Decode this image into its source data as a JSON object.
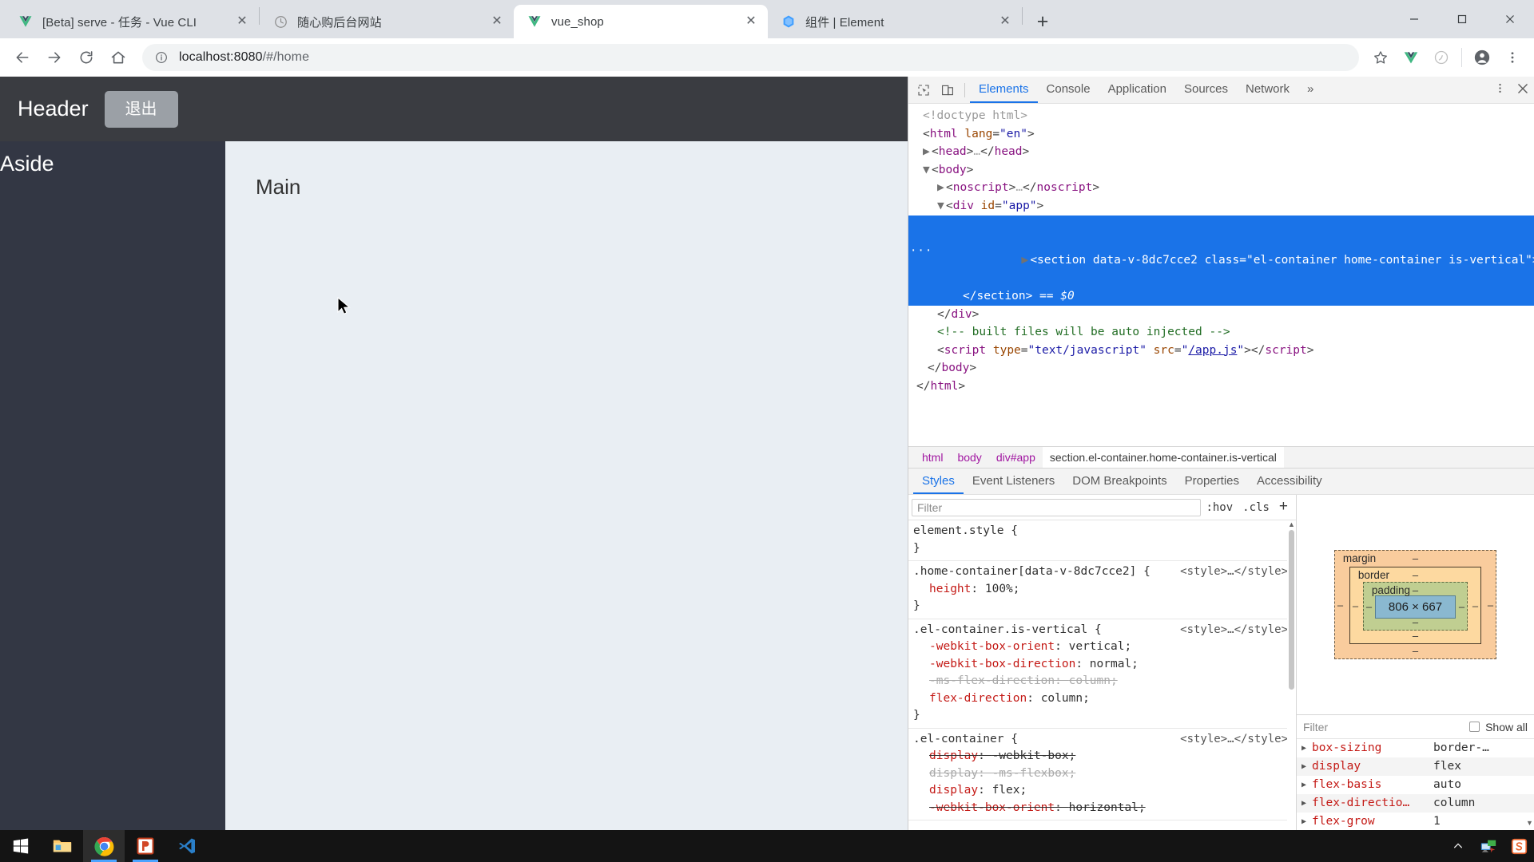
{
  "browser": {
    "tabs": [
      {
        "title": "[Beta] serve - 任务 - Vue CLI",
        "favicon": "vue-icon",
        "active": false,
        "close_label": "✕"
      },
      {
        "title": "随心购后台网站",
        "favicon": "clock-icon",
        "active": false,
        "close_label": "✕"
      },
      {
        "title": "vue_shop",
        "favicon": "vue-icon",
        "active": true,
        "close_label": "✕"
      },
      {
        "title": "组件 | Element",
        "favicon": "element-icon",
        "active": false,
        "close_label": "✕"
      }
    ],
    "new_tab_label": "+",
    "window_controls": {
      "minimize": "—",
      "maximize": "▢",
      "close": "✕"
    },
    "nav": {
      "back": "←",
      "forward": "→",
      "reload": "⟳",
      "home": "⌂"
    },
    "omnibox": {
      "info_icon": "info-circle-icon",
      "host": "localhost:8080",
      "path": "/#/home",
      "full_url": "localhost:8080/#/home"
    },
    "toolbar_icons": [
      "bookmark-star-icon",
      "vue-devtools-icon",
      "extension-icon",
      "profile-icon",
      "chrome-menu-icon"
    ]
  },
  "page": {
    "header_title": "Header",
    "logout_button": "退出",
    "aside_title": "Aside",
    "main_title": "Main"
  },
  "devtools": {
    "toolbar_icons": [
      "inspect-element-icon",
      "device-toolbar-icon"
    ],
    "tabs": [
      "Elements",
      "Console",
      "Application",
      "Sources",
      "Network"
    ],
    "active_tab": "Elements",
    "overflow_label": "»",
    "settings_icon": "kebab-menu-icon",
    "close_icon": "close-icon",
    "dom": [
      {
        "indent": 0,
        "arrow": "",
        "type": "doctype",
        "text": "<!doctype html>"
      },
      {
        "indent": 0,
        "arrow": "",
        "type": "open",
        "tag": "html",
        "attrs": " lang=\"en\""
      },
      {
        "indent": 0,
        "arrow": "▶",
        "type": "collapsed",
        "tag": "head"
      },
      {
        "indent": 0,
        "arrow": "▼",
        "type": "open",
        "tag": "body",
        "attrs": ""
      },
      {
        "indent": 1,
        "arrow": "▶",
        "type": "collapsed",
        "tag": "noscript"
      },
      {
        "indent": 1,
        "arrow": "▼",
        "type": "open",
        "tag": "div",
        "attrs": " id=\"app\""
      },
      {
        "indent": 2,
        "arrow": "▶",
        "type": "selected",
        "tag": "section",
        "attrs": " data-v-8dc7cce2 class=\"el-container home-container is-vertical\"",
        "suffix": "…",
        "closing": "</section>",
        "marker": "== $0"
      },
      {
        "indent": 1,
        "arrow": "",
        "type": "close",
        "tag": "div"
      },
      {
        "indent": 1,
        "arrow": "",
        "type": "comment",
        "text": "<!-- built files will be auto injected -->"
      },
      {
        "indent": 1,
        "arrow": "",
        "type": "script",
        "text": "<script type=\"text/javascript\" src=\"/app.js\"></script>",
        "src": "/app.js"
      },
      {
        "indent": 0,
        "arrow": "",
        "type": "close",
        "tag": "body"
      },
      {
        "indent": 0,
        "arrow": "",
        "type": "close",
        "tag": "html"
      }
    ],
    "breadcrumbs": [
      "html",
      "body",
      "div#app",
      "section.el-container.home-container.is-vertical"
    ],
    "style_tabs": [
      "Styles",
      "Event Listeners",
      "DOM Breakpoints",
      "Properties",
      "Accessibility"
    ],
    "active_style_tab": "Styles",
    "filter_placeholder": "Filter",
    "hov_label": ":hov",
    "cls_label": ".cls",
    "add_rule_label": "+",
    "rules": [
      {
        "selector": "element.style {",
        "source": "",
        "declarations": [],
        "close": "}"
      },
      {
        "selector": ".home-container[data-v-8dc7cce2] {",
        "source": "<style>…</style>",
        "declarations": [
          {
            "prop": "height",
            "value": "100%;",
            "strike": false,
            "dim": false
          }
        ],
        "close": "}"
      },
      {
        "selector": ".el-container.is-vertical {",
        "source": "<style>…</style>",
        "declarations": [
          {
            "prop": "-webkit-box-orient",
            "value": "vertical;",
            "strike": false,
            "dim": false
          },
          {
            "prop": "-webkit-box-direction",
            "value": "normal;",
            "strike": false,
            "dim": false
          },
          {
            "prop": "-ms-flex-direction",
            "value": "column;",
            "strike": true,
            "dim": true
          },
          {
            "prop": "flex-direction",
            "value": "column;",
            "strike": false,
            "dim": false
          }
        ],
        "close": "}"
      },
      {
        "selector": ".el-container {",
        "source": "<style>…</style>",
        "declarations": [
          {
            "prop": "display",
            "value": "-webkit-box;",
            "strike": true,
            "dim": false
          },
          {
            "prop": "display",
            "value": "-ms-flexbox;",
            "strike": true,
            "dim": true
          },
          {
            "prop": "display",
            "value": "flex;",
            "strike": false,
            "dim": false
          },
          {
            "prop": "-webkit-box-orient",
            "value": "horizontal;",
            "strike": true,
            "dim": false
          }
        ],
        "close": ""
      }
    ],
    "box_model": {
      "margin_label": "margin",
      "margin_value": "–",
      "border_label": "border",
      "border_value": "–",
      "padding_label": "padding",
      "padding_value": "–",
      "content": "806 × 667",
      "dash": "–"
    },
    "computed": {
      "filter_placeholder": "Filter",
      "show_all_label": "Show all",
      "show_all_checked": false,
      "properties": [
        {
          "name": "box-sizing",
          "value": "border-…"
        },
        {
          "name": "display",
          "value": "flex"
        },
        {
          "name": "flex-basis",
          "value": "auto"
        },
        {
          "name": "flex-directio…",
          "value": "column"
        },
        {
          "name": "flex-grow",
          "value": "1"
        }
      ]
    }
  },
  "taskbar": {
    "items": [
      "windows-start-icon",
      "file-explorer-icon",
      "chrome-icon",
      "powerpoint-icon",
      "vscode-icon"
    ],
    "tray": [
      "show-hidden-icons-chevron",
      "network-icon",
      "snipaste-icon"
    ]
  },
  "colors": {
    "accent": "#1a73e8",
    "tab_active_bg": "#ffffff",
    "tabstrip_bg": "#dee1e6",
    "page_header_bg": "#3a3c41",
    "page_aside_bg": "#333744",
    "page_main_bg": "#e9eef3",
    "taskbar_bg": "#141414",
    "selected_row": "#1a73e8"
  }
}
